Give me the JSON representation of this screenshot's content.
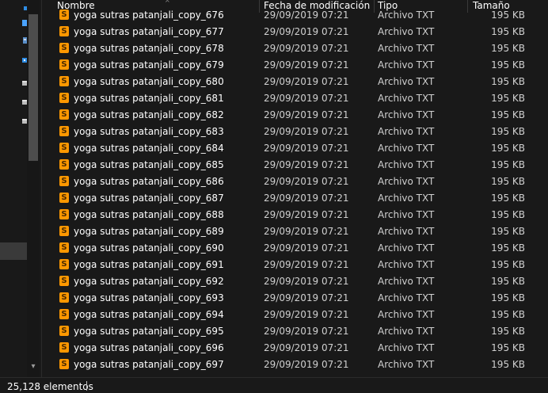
{
  "header": {
    "columns": [
      "Nombre",
      "Fecha de modificación",
      "Tipo",
      "Tamaño"
    ]
  },
  "rows": [
    {
      "name": "yoga sutras patanjali_copy_676",
      "date": "29/09/2019 07:21",
      "type": "Archivo TXT",
      "size": "195 KB"
    },
    {
      "name": "yoga sutras patanjali_copy_677",
      "date": "29/09/2019 07:21",
      "type": "Archivo TXT",
      "size": "195 KB"
    },
    {
      "name": "yoga sutras patanjali_copy_678",
      "date": "29/09/2019 07:21",
      "type": "Archivo TXT",
      "size": "195 KB"
    },
    {
      "name": "yoga sutras patanjali_copy_679",
      "date": "29/09/2019 07:21",
      "type": "Archivo TXT",
      "size": "195 KB"
    },
    {
      "name": "yoga sutras patanjali_copy_680",
      "date": "29/09/2019 07:21",
      "type": "Archivo TXT",
      "size": "195 KB"
    },
    {
      "name": "yoga sutras patanjali_copy_681",
      "date": "29/09/2019 07:21",
      "type": "Archivo TXT",
      "size": "195 KB"
    },
    {
      "name": "yoga sutras patanjali_copy_682",
      "date": "29/09/2019 07:21",
      "type": "Archivo TXT",
      "size": "195 KB"
    },
    {
      "name": "yoga sutras patanjali_copy_683",
      "date": "29/09/2019 07:21",
      "type": "Archivo TXT",
      "size": "195 KB"
    },
    {
      "name": "yoga sutras patanjali_copy_684",
      "date": "29/09/2019 07:21",
      "type": "Archivo TXT",
      "size": "195 KB"
    },
    {
      "name": "yoga sutras patanjali_copy_685",
      "date": "29/09/2019 07:21",
      "type": "Archivo TXT",
      "size": "195 KB"
    },
    {
      "name": "yoga sutras patanjali_copy_686",
      "date": "29/09/2019 07:21",
      "type": "Archivo TXT",
      "size": "195 KB"
    },
    {
      "name": "yoga sutras patanjali_copy_687",
      "date": "29/09/2019 07:21",
      "type": "Archivo TXT",
      "size": "195 KB"
    },
    {
      "name": "yoga sutras patanjali_copy_688",
      "date": "29/09/2019 07:21",
      "type": "Archivo TXT",
      "size": "195 KB"
    },
    {
      "name": "yoga sutras patanjali_copy_689",
      "date": "29/09/2019 07:21",
      "type": "Archivo TXT",
      "size": "195 KB"
    },
    {
      "name": "yoga sutras patanjali_copy_690",
      "date": "29/09/2019 07:21",
      "type": "Archivo TXT",
      "size": "195 KB"
    },
    {
      "name": "yoga sutras patanjali_copy_691",
      "date": "29/09/2019 07:21",
      "type": "Archivo TXT",
      "size": "195 KB"
    },
    {
      "name": "yoga sutras patanjali_copy_692",
      "date": "29/09/2019 07:21",
      "type": "Archivo TXT",
      "size": "195 KB"
    },
    {
      "name": "yoga sutras patanjali_copy_693",
      "date": "29/09/2019 07:21",
      "type": "Archivo TXT",
      "size": "195 KB"
    },
    {
      "name": "yoga sutras patanjali_copy_694",
      "date": "29/09/2019 07:21",
      "type": "Archivo TXT",
      "size": "195 KB"
    },
    {
      "name": "yoga sutras patanjali_copy_695",
      "date": "29/09/2019 07:21",
      "type": "Archivo TXT",
      "size": "195 KB"
    },
    {
      "name": "yoga sutras patanjali_copy_696",
      "date": "29/09/2019 07:21",
      "type": "Archivo TXT",
      "size": "195 KB"
    },
    {
      "name": "yoga sutras patanjali_copy_697",
      "date": "29/09/2019 07:21",
      "type": "Archivo TXT",
      "size": "195 KB"
    }
  ],
  "status": {
    "item_count": "25,128 elementos"
  },
  "icons": {
    "file": "sublime-text-file-icon",
    "file_glyph": "S",
    "scroll_down": "▾"
  },
  "colors": {
    "background": "#191919",
    "file_icon": "#ff9800",
    "text": "#ffffff"
  }
}
